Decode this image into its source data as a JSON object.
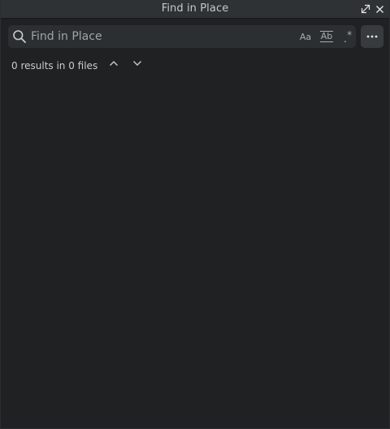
{
  "window": {
    "title": "Find in Place"
  },
  "titlebar": {
    "restore_icon": "restore-window-icon",
    "close_icon": "close-icon"
  },
  "search": {
    "placeholder": "Find in Place",
    "value": "",
    "options": {
      "match_case_label": "Aa",
      "whole_word_label": "Ab",
      "regex_dot": ".",
      "regex_star": "*"
    }
  },
  "status": {
    "results_text": "0 results in 0 files"
  },
  "colors": {
    "background": "#1f2122",
    "titlebar": "#2f3234",
    "input_bg": "#2c2f31",
    "button_bg": "#383b3d",
    "text": "#d7dadc",
    "muted": "#9fa4a7"
  }
}
